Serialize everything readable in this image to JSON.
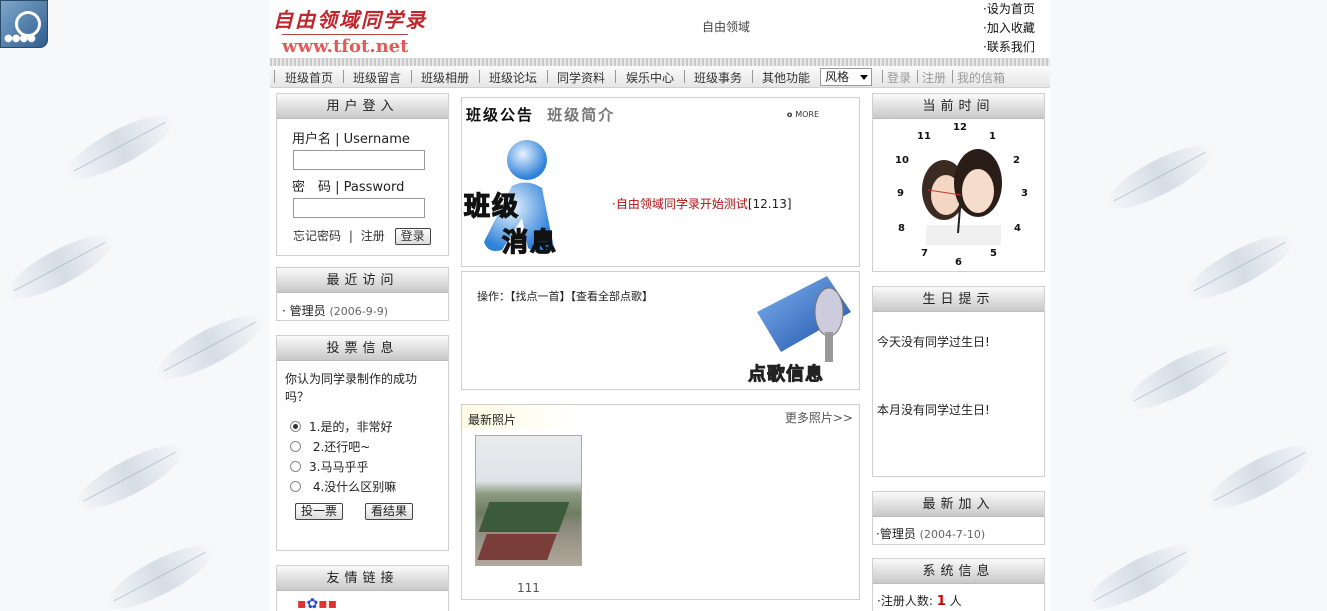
{
  "header": {
    "site_title": "自由领域同学录",
    "site_url": "www.tfot.net",
    "center_text": "自由领域",
    "top_links": [
      "·设为首页",
      "·加入收藏",
      "·联系我们"
    ]
  },
  "nav": {
    "items": [
      "班级首页",
      "班级留言",
      "班级相册",
      "班级论坛",
      "同学资料",
      "娱乐中心",
      "班级事务",
      "其他功能"
    ],
    "style_select": "风格",
    "right_links": [
      "登录",
      "注册",
      "我的信箱"
    ]
  },
  "login": {
    "title": "用户登入",
    "username_label": "用户名 | Username",
    "password_label": "密　码 | Password",
    "forgot": "忘记密码",
    "register": "注册",
    "login_button": "登录"
  },
  "recent": {
    "title": "最近访问",
    "entry_name": "· 管理员",
    "entry_date": "(2006-9-9)"
  },
  "vote": {
    "title": "投票信息",
    "question": "你认为同学录制作的成功吗？",
    "options": [
      "1.是的，非常好",
      " 2.还行吧~",
      "3.马马乎乎",
      " 4.没什么区别嘛"
    ],
    "vote_button": "投一票",
    "result_button": "看结果"
  },
  "links": {
    "title": "友情链接"
  },
  "announce": {
    "tab_active": "班级公告",
    "tab_inactive": "班级简介",
    "more": "MORE",
    "badge_line1": "班级",
    "badge_line2": "消息",
    "news_title": "·自由领域同学录开始测试",
    "news_date": "[12.13]"
  },
  "song": {
    "operation": "操作：【找点一首】【查看全部点歌】",
    "badge": "点歌信息"
  },
  "photos": {
    "title": "最新照片",
    "more": "更多照片>>",
    "caption": "111"
  },
  "time": {
    "title": "当前时间",
    "numbers": [
      "12",
      "1",
      "2",
      "3",
      "4",
      "5",
      "6",
      "7",
      "8",
      "9",
      "10",
      "11"
    ]
  },
  "birthday": {
    "title": "生日提示",
    "today": "今天没有同学过生日!",
    "month": "本月没有同学过生日!"
  },
  "newest": {
    "title": "最新加入",
    "entry_name": "·管理员",
    "entry_date": "(2004-7-10)"
  },
  "system": {
    "title": "系统信息",
    "label": "·注册人数:",
    "count": "1",
    "unit": "人"
  }
}
